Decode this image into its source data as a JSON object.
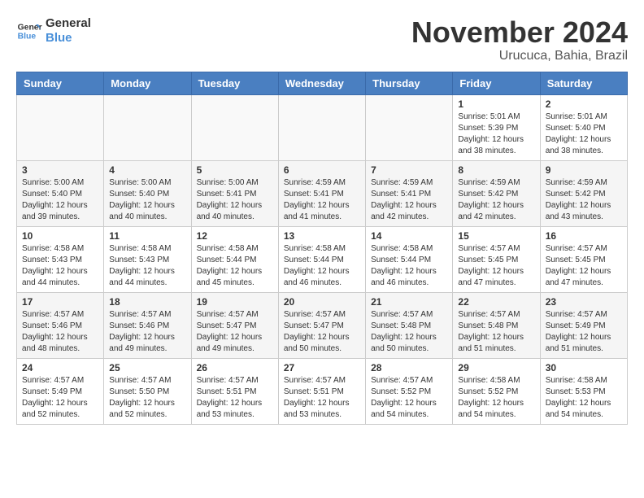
{
  "header": {
    "logo_line1": "General",
    "logo_line2": "Blue",
    "month": "November 2024",
    "location": "Urucuca, Bahia, Brazil"
  },
  "days_of_week": [
    "Sunday",
    "Monday",
    "Tuesday",
    "Wednesday",
    "Thursday",
    "Friday",
    "Saturday"
  ],
  "weeks": [
    [
      {
        "day": "",
        "sunrise": "",
        "sunset": "",
        "daylight": ""
      },
      {
        "day": "",
        "sunrise": "",
        "sunset": "",
        "daylight": ""
      },
      {
        "day": "",
        "sunrise": "",
        "sunset": "",
        "daylight": ""
      },
      {
        "day": "",
        "sunrise": "",
        "sunset": "",
        "daylight": ""
      },
      {
        "day": "",
        "sunrise": "",
        "sunset": "",
        "daylight": ""
      },
      {
        "day": "1",
        "sunrise": "5:01 AM",
        "sunset": "5:39 PM",
        "daylight": "12 hours and 38 minutes."
      },
      {
        "day": "2",
        "sunrise": "5:01 AM",
        "sunset": "5:40 PM",
        "daylight": "12 hours and 38 minutes."
      }
    ],
    [
      {
        "day": "3",
        "sunrise": "5:00 AM",
        "sunset": "5:40 PM",
        "daylight": "12 hours and 39 minutes."
      },
      {
        "day": "4",
        "sunrise": "5:00 AM",
        "sunset": "5:40 PM",
        "daylight": "12 hours and 40 minutes."
      },
      {
        "day": "5",
        "sunrise": "5:00 AM",
        "sunset": "5:41 PM",
        "daylight": "12 hours and 40 minutes."
      },
      {
        "day": "6",
        "sunrise": "4:59 AM",
        "sunset": "5:41 PM",
        "daylight": "12 hours and 41 minutes."
      },
      {
        "day": "7",
        "sunrise": "4:59 AM",
        "sunset": "5:41 PM",
        "daylight": "12 hours and 42 minutes."
      },
      {
        "day": "8",
        "sunrise": "4:59 AM",
        "sunset": "5:42 PM",
        "daylight": "12 hours and 42 minutes."
      },
      {
        "day": "9",
        "sunrise": "4:59 AM",
        "sunset": "5:42 PM",
        "daylight": "12 hours and 43 minutes."
      }
    ],
    [
      {
        "day": "10",
        "sunrise": "4:58 AM",
        "sunset": "5:43 PM",
        "daylight": "12 hours and 44 minutes."
      },
      {
        "day": "11",
        "sunrise": "4:58 AM",
        "sunset": "5:43 PM",
        "daylight": "12 hours and 44 minutes."
      },
      {
        "day": "12",
        "sunrise": "4:58 AM",
        "sunset": "5:44 PM",
        "daylight": "12 hours and 45 minutes."
      },
      {
        "day": "13",
        "sunrise": "4:58 AM",
        "sunset": "5:44 PM",
        "daylight": "12 hours and 46 minutes."
      },
      {
        "day": "14",
        "sunrise": "4:58 AM",
        "sunset": "5:44 PM",
        "daylight": "12 hours and 46 minutes."
      },
      {
        "day": "15",
        "sunrise": "4:57 AM",
        "sunset": "5:45 PM",
        "daylight": "12 hours and 47 minutes."
      },
      {
        "day": "16",
        "sunrise": "4:57 AM",
        "sunset": "5:45 PM",
        "daylight": "12 hours and 47 minutes."
      }
    ],
    [
      {
        "day": "17",
        "sunrise": "4:57 AM",
        "sunset": "5:46 PM",
        "daylight": "12 hours and 48 minutes."
      },
      {
        "day": "18",
        "sunrise": "4:57 AM",
        "sunset": "5:46 PM",
        "daylight": "12 hours and 49 minutes."
      },
      {
        "day": "19",
        "sunrise": "4:57 AM",
        "sunset": "5:47 PM",
        "daylight": "12 hours and 49 minutes."
      },
      {
        "day": "20",
        "sunrise": "4:57 AM",
        "sunset": "5:47 PM",
        "daylight": "12 hours and 50 minutes."
      },
      {
        "day": "21",
        "sunrise": "4:57 AM",
        "sunset": "5:48 PM",
        "daylight": "12 hours and 50 minutes."
      },
      {
        "day": "22",
        "sunrise": "4:57 AM",
        "sunset": "5:48 PM",
        "daylight": "12 hours and 51 minutes."
      },
      {
        "day": "23",
        "sunrise": "4:57 AM",
        "sunset": "5:49 PM",
        "daylight": "12 hours and 51 minutes."
      }
    ],
    [
      {
        "day": "24",
        "sunrise": "4:57 AM",
        "sunset": "5:49 PM",
        "daylight": "12 hours and 52 minutes."
      },
      {
        "day": "25",
        "sunrise": "4:57 AM",
        "sunset": "5:50 PM",
        "daylight": "12 hours and 52 minutes."
      },
      {
        "day": "26",
        "sunrise": "4:57 AM",
        "sunset": "5:51 PM",
        "daylight": "12 hours and 53 minutes."
      },
      {
        "day": "27",
        "sunrise": "4:57 AM",
        "sunset": "5:51 PM",
        "daylight": "12 hours and 53 minutes."
      },
      {
        "day": "28",
        "sunrise": "4:57 AM",
        "sunset": "5:52 PM",
        "daylight": "12 hours and 54 minutes."
      },
      {
        "day": "29",
        "sunrise": "4:58 AM",
        "sunset": "5:52 PM",
        "daylight": "12 hours and 54 minutes."
      },
      {
        "day": "30",
        "sunrise": "4:58 AM",
        "sunset": "5:53 PM",
        "daylight": "12 hours and 54 minutes."
      }
    ]
  ]
}
